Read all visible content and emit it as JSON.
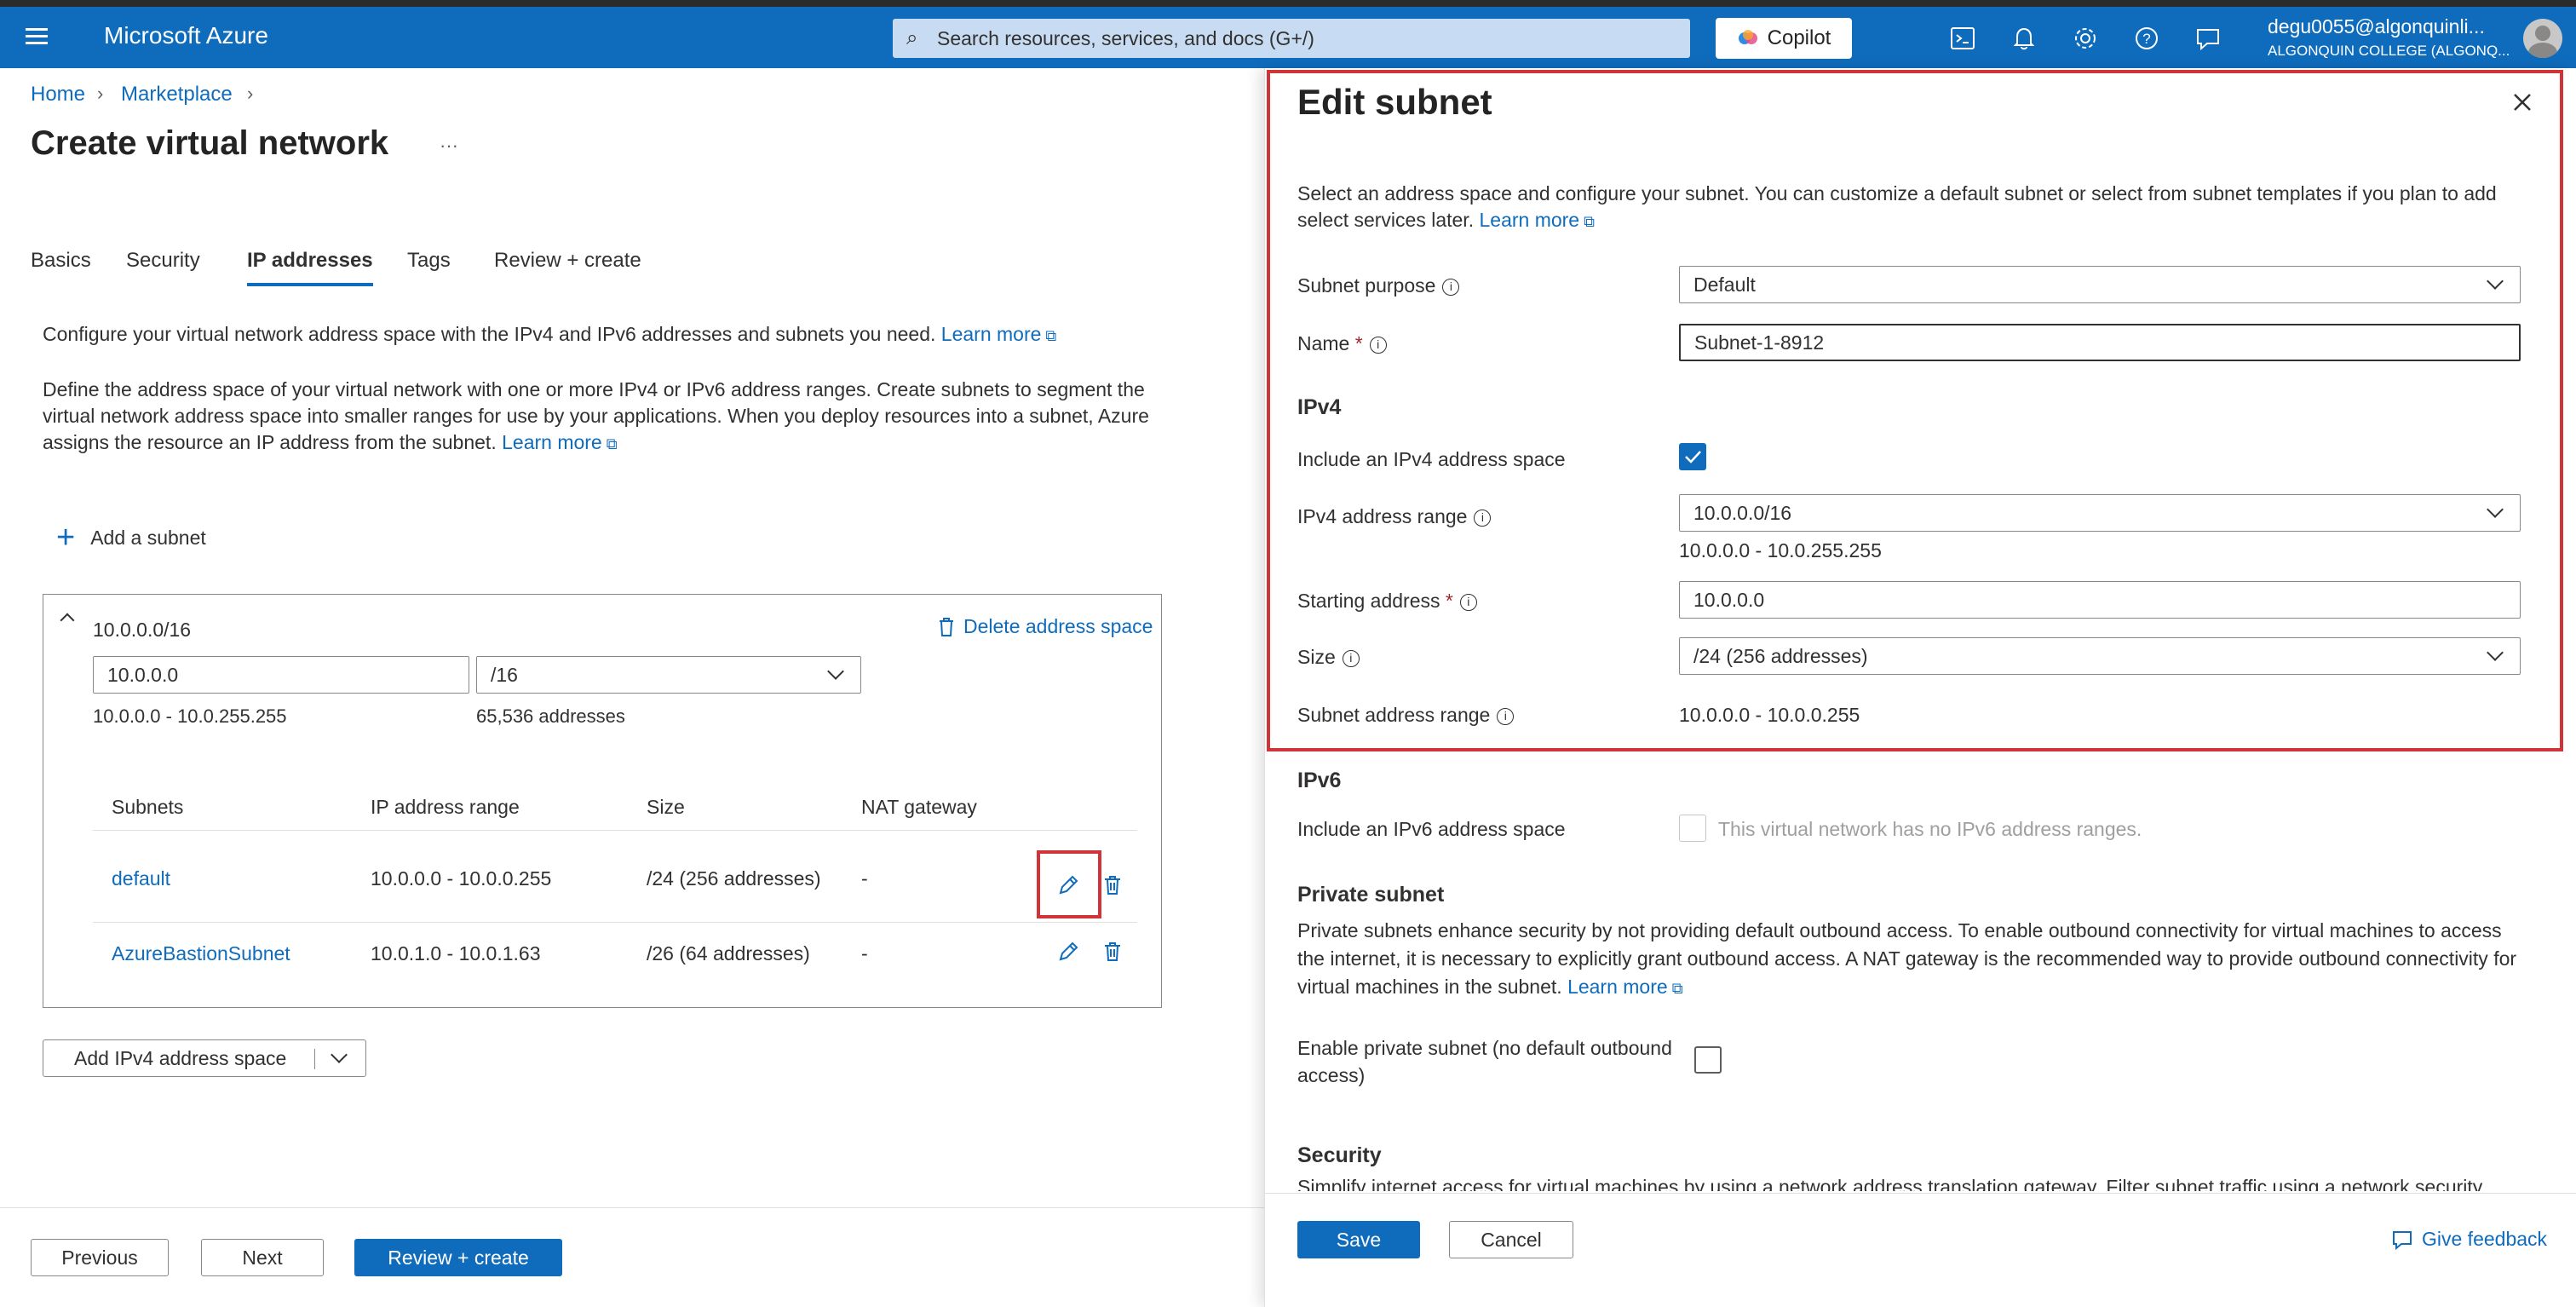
{
  "topbar": {
    "app_title": "Microsoft Azure",
    "search_placeholder": "Search resources, services, and docs (G+/)",
    "copilot_label": "Copilot",
    "user_email": "degu0055@algonquinli...",
    "user_org": "ALGONQUIN COLLEGE (ALGONQ..."
  },
  "breadcrumb": {
    "home": "Home",
    "marketplace": "Marketplace"
  },
  "page": {
    "title": "Create virtual network",
    "more": "···"
  },
  "tabs": [
    "Basics",
    "Security",
    "IP addresses",
    "Tags",
    "Review + create"
  ],
  "ip": {
    "intro": "Configure your virtual network address space with the IPv4 and IPv6 addresses and subnets you need.",
    "intro_link": "Learn more",
    "define_text": "Define the address space of your virtual network with one or more IPv4 or IPv6 address ranges. Create subnets to segment the virtual network address space into smaller ranges for use by your applications. When you deploy resources into a subnet, Azure assigns the resource an IP address from the subnet.",
    "define_link": "Learn more",
    "add_subnet": "Add a subnet",
    "address_space": {
      "title": "10.0.0.0/16",
      "delete_label": "Delete address space",
      "start_value": "10.0.0.0",
      "prefix_value": "/16",
      "range": "10.0.0.0 - 10.0.255.255",
      "count": "65,536 addresses"
    },
    "subnet_headers": [
      "Subnets",
      "IP address range",
      "Size",
      "NAT gateway"
    ],
    "subnets": [
      {
        "name": "default",
        "range": "10.0.0.0 - 10.0.0.255",
        "size": "/24 (256 addresses)",
        "nat": "-"
      },
      {
        "name": "AzureBastionSubnet",
        "range": "10.0.1.0 - 10.0.1.63",
        "size": "/26 (64 addresses)",
        "nat": "-"
      }
    ],
    "add_ipv4": "Add IPv4 address space"
  },
  "footer": {
    "previous": "Previous",
    "next": "Next",
    "review": "Review + create"
  },
  "panel": {
    "title": "Edit subnet",
    "description": "Select an address space and configure your subnet. You can customize a default subnet or select from subnet templates if you plan to add select services later.",
    "description_link": "Learn more",
    "subnet_purpose_label": "Subnet purpose",
    "subnet_purpose_value": "Default",
    "name_label": "Name",
    "name_value": "Subnet-1-8912",
    "ipv4_heading": "IPv4",
    "include_ipv4_label": "Include an IPv4 address space",
    "ipv4_range_label": "IPv4 address range",
    "ipv4_range_value": "10.0.0.0/16",
    "ipv4_range_hint": "10.0.0.0 - 10.0.255.255",
    "starting_address_label": "Starting address",
    "starting_address_value": "10.0.0.0",
    "size_label": "Size",
    "size_value": "/24 (256 addresses)",
    "subnet_range_label": "Subnet address range",
    "subnet_range_value": "10.0.0.0 - 10.0.0.255",
    "ipv6_heading": "IPv6",
    "include_ipv6_label": "Include an IPv6 address space",
    "ipv6_note": "This virtual network has no IPv6 address ranges.",
    "private_heading": "Private subnet",
    "private_text": "Private subnets enhance security by not providing default outbound access. To enable outbound connectivity for virtual machines to access the internet, it is necessary to explicitly grant outbound access. A NAT gateway is the recommended way to provide outbound connectivity for virtual machines in the subnet.",
    "private_link": "Learn more",
    "enable_private_label": "Enable private subnet (no default outbound access)",
    "security_heading": "Security",
    "security_text": "Simplify internet access for virtual machines by using a network address translation gateway. Filter subnet traffic using a network security",
    "save": "Save",
    "cancel": "Cancel",
    "feedback": "Give feedback"
  }
}
